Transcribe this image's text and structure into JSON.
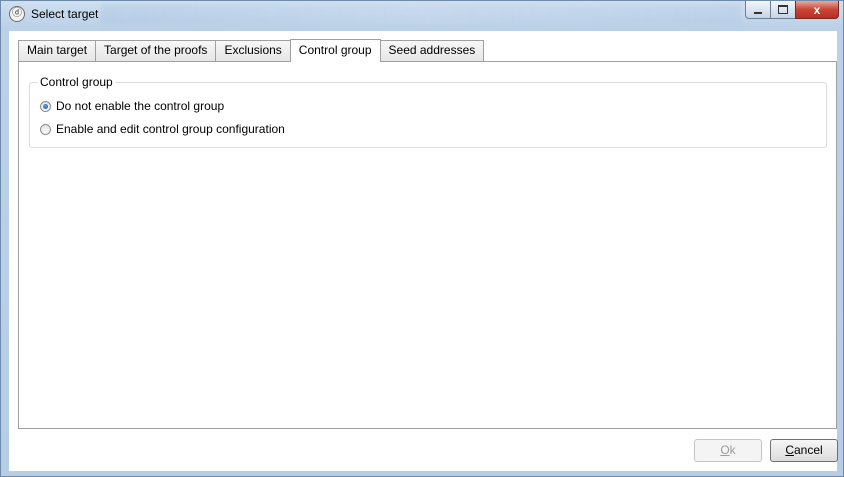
{
  "window": {
    "title": "Select target",
    "icon": "app-logo-icon",
    "minimize_icon": "minimize-icon",
    "maximize_icon": "maximize-icon",
    "close_icon": "close-icon",
    "close_glyph": "x"
  },
  "tabs": [
    {
      "label": "Main target",
      "active": false
    },
    {
      "label": "Target of the proofs",
      "active": false
    },
    {
      "label": "Exclusions",
      "active": false
    },
    {
      "label": "Control group",
      "active": true
    },
    {
      "label": "Seed addresses",
      "active": false
    }
  ],
  "control_group": {
    "legend": "Control group",
    "options": [
      {
        "label": "Do not enable the control group",
        "checked": true
      },
      {
        "label": "Enable and edit control group configuration",
        "checked": false
      }
    ]
  },
  "buttons": {
    "ok": {
      "first": "O",
      "rest": "k",
      "enabled": false
    },
    "cancel": {
      "first": "C",
      "rest": "ancel",
      "enabled": true
    }
  },
  "colors": {
    "frame": "#bcd1e8",
    "close_button": "#c9453a",
    "radio_checked": "#1d4f9a",
    "disabled_text": "#9c9c9c"
  }
}
